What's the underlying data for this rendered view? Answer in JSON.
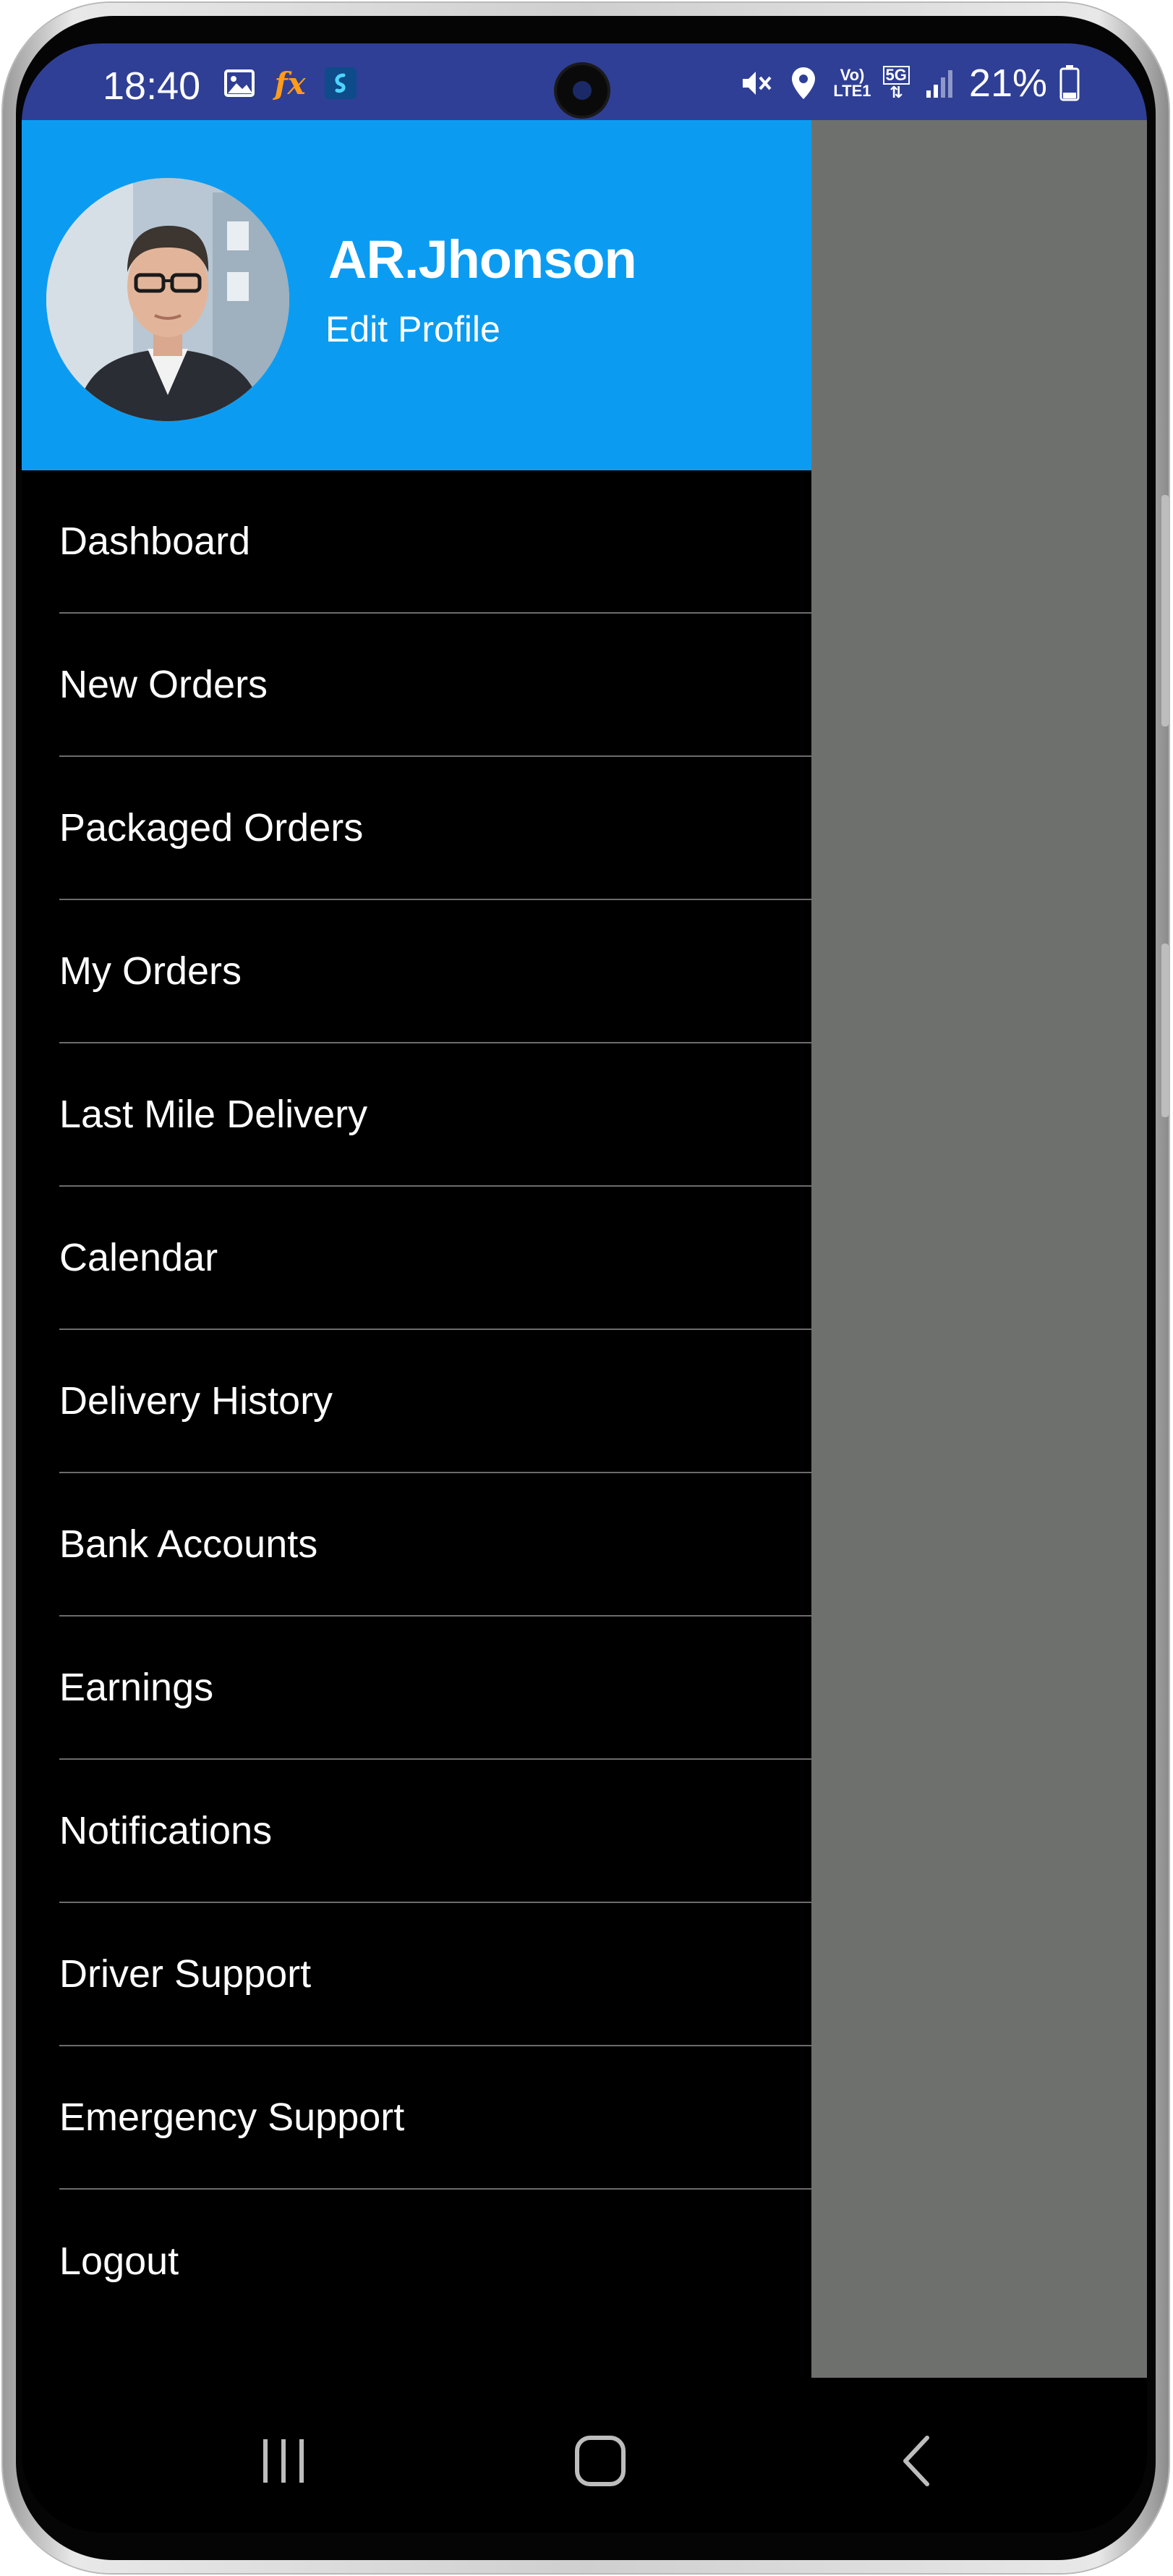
{
  "status_bar": {
    "time": "18:40",
    "battery": "21%",
    "net_top": "Vo)",
    "net_bottom": "LTE1",
    "net_gen": "5G",
    "fx": "fx"
  },
  "profile": {
    "name": "AR.Jhonson",
    "edit_label": "Edit Profile"
  },
  "menu": {
    "items": [
      {
        "label": "Dashboard"
      },
      {
        "label": "New Orders"
      },
      {
        "label": "Packaged Orders"
      },
      {
        "label": "My Orders"
      },
      {
        "label": "Last Mile Delivery"
      },
      {
        "label": "Calendar"
      },
      {
        "label": "Delivery History"
      },
      {
        "label": "Bank Accounts"
      },
      {
        "label": "Earnings"
      },
      {
        "label": "Notifications"
      },
      {
        "label": "Driver Support"
      },
      {
        "label": "Emergency Support"
      },
      {
        "label": "Logout"
      }
    ]
  },
  "icons": {
    "gallery": "image-icon",
    "fx": "fx-app-icon",
    "app": "shazam-icon",
    "mute": "vibrate-mute-icon",
    "location": "location-pin-icon",
    "signal": "signal-bars-icon",
    "battery": "battery-icon",
    "recents": "recent-apps-icon",
    "home": "home-icon",
    "back": "back-icon"
  },
  "colors": {
    "status_bar": "#2f3f95",
    "header": "#0b9cf2",
    "drawer": "#000000",
    "scrim": "#6e706e"
  }
}
